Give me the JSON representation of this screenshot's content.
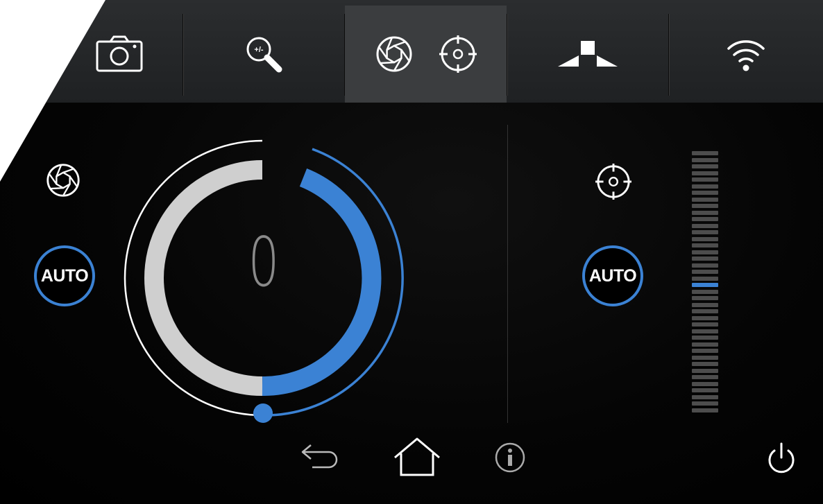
{
  "topbar": {
    "tabs": [
      {
        "id": "camera",
        "icon": "camera-icon"
      },
      {
        "id": "zoom",
        "icon": "zoom-plus-minus-icon",
        "label": "+/-"
      },
      {
        "id": "aperture-focus",
        "icon": "aperture-icon",
        "icon2": "focus-target-icon",
        "active": true
      },
      {
        "id": "position",
        "icon": "tilt-position-icon"
      },
      {
        "id": "wifi",
        "icon": "wifi-icon"
      }
    ]
  },
  "iris_panel": {
    "icon": "aperture-icon",
    "auto_label": "AUTO",
    "dial_value": "0",
    "dial_fraction": 0.5
  },
  "focus_panel": {
    "icon": "focus-target-icon",
    "auto_label": "AUTO",
    "scale_ticks": 40,
    "scale_active_index": 20
  },
  "bottom_nav": {
    "items": [
      "back-icon",
      "home-icon",
      "info-icon",
      "power-icon"
    ]
  },
  "colors": {
    "accent": "#3b82d4",
    "ring_grey": "#cfcfcf",
    "tab_active": "#3b3d3f",
    "tick": "#4d4d4d"
  }
}
